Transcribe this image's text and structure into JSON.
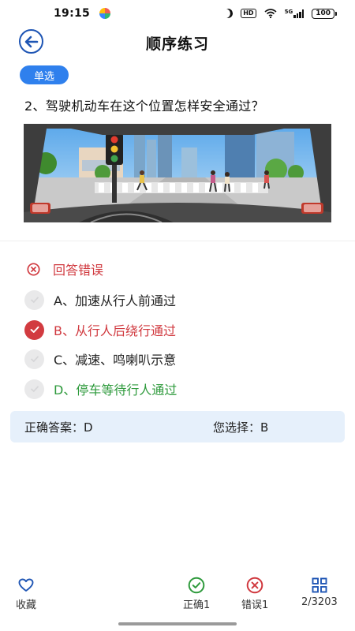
{
  "status_bar": {
    "time": "19:15",
    "battery": "100",
    "network_badge": "HD",
    "signal_label": "5G"
  },
  "header": {
    "title": "顺序练习",
    "back_icon": "arrow-left-icon"
  },
  "question": {
    "type_badge": "单选",
    "text": "2、驾驶机动车在这个位置怎样安全通过？"
  },
  "result": {
    "text": "回答错误",
    "icon": "x-circle-icon",
    "color": "#d0383e"
  },
  "options": [
    {
      "text": "A、加速从行人前通过",
      "state": "neutral"
    },
    {
      "text": "B、从行人后绕行通过",
      "state": "selected-wrong"
    },
    {
      "text": "C、减速、鸣喇叭示意",
      "state": "neutral"
    },
    {
      "text": "D、停车等待行人通过",
      "state": "correct"
    }
  ],
  "answer": {
    "correct_label": "正确答案：D",
    "chosen_label": "您选择：B"
  },
  "bottom_bar": {
    "favorite": {
      "label": "收藏",
      "icon": "heart-icon"
    },
    "correct": {
      "label": "正确1",
      "icon": "check-circle-icon"
    },
    "wrong": {
      "label": "错误1",
      "icon": "x-circle-icon"
    },
    "progress": {
      "label": "2/3203",
      "icon": "grid-icon"
    }
  },
  "colors": {
    "primary": "#1e55b4",
    "badge": "#2f80ed",
    "wrong": "#d0383e",
    "correct": "#2e9a3c",
    "answer_bg": "#e6f0fb"
  }
}
